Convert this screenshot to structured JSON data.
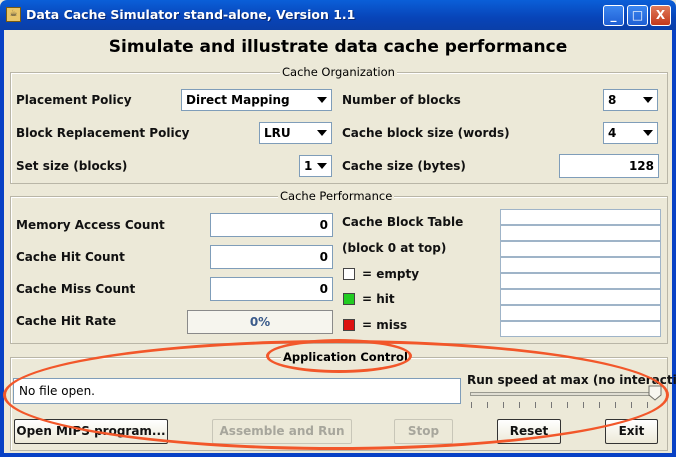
{
  "window": {
    "title": "Data Cache Simulator stand-alone, Version 1.1",
    "buttons": {
      "minimize": "_",
      "maximize": "□",
      "close": "X"
    }
  },
  "heading": "Simulate and illustrate data cache performance",
  "organization": {
    "title": "Cache Organization",
    "placement_policy": {
      "label": "Placement Policy",
      "value": "Direct Mapping"
    },
    "replacement_policy": {
      "label": "Block Replacement Policy",
      "value": "LRU"
    },
    "set_size": {
      "label": "Set size (blocks)",
      "value": "1"
    },
    "num_blocks": {
      "label": "Number of blocks",
      "value": "8"
    },
    "block_size": {
      "label": "Cache block size (words)",
      "value": "4"
    },
    "cache_size": {
      "label": "Cache size (bytes)",
      "value": "128"
    }
  },
  "performance": {
    "title": "Cache Performance",
    "access_count": {
      "label": "Memory Access Count",
      "value": "0"
    },
    "hit_count": {
      "label": "Cache Hit Count",
      "value": "0"
    },
    "miss_count": {
      "label": "Cache Miss Count",
      "value": "0"
    },
    "hit_rate": {
      "label": "Cache Hit Rate",
      "value": "0%",
      "fraction": 0
    },
    "block_table_label": "Cache Block Table",
    "block_table_note": "(block 0 at top)",
    "legend": [
      {
        "label": "= empty",
        "color": "#ffffff"
      },
      {
        "label": "= hit",
        "color": "#22cc22"
      },
      {
        "label": "= miss",
        "color": "#dd1111"
      }
    ],
    "block_table_cells": 8
  },
  "control": {
    "title": "Application Control",
    "status": "No file open.",
    "speed_label": "Run speed at max (no interaction)",
    "speed_level": 1.0,
    "buttons": {
      "open": "Open MIPS program...",
      "assemble": "Assemble and Run",
      "stop": "Stop",
      "reset": "Reset",
      "exit": "Exit"
    }
  },
  "colors": {
    "titlebar": "#0a5fd8",
    "background": "#ece9d8",
    "annotation": "#f2572a"
  }
}
